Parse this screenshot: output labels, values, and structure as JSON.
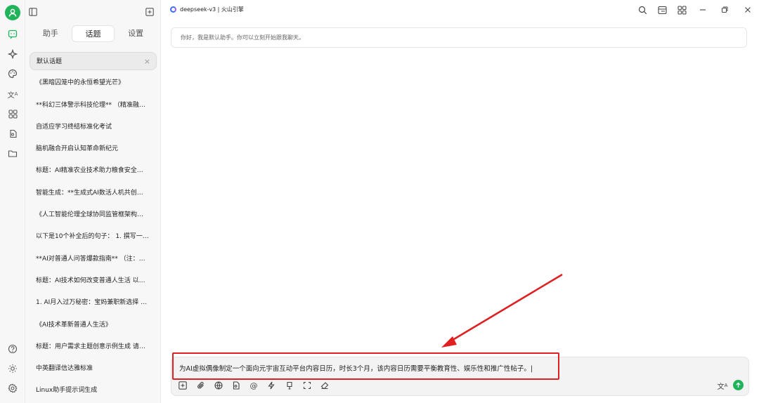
{
  "window": {
    "model_label": "deepseek-v3 | 火山引擎"
  },
  "sidebar": {
    "tabs": [
      "助手",
      "话题",
      "设置"
    ],
    "active_tab": "话题",
    "topics": [
      "默认话题",
      "《黑暗囚笼中的永恒希望光芒》",
      "**科幻三体警示科技伦理** （精准融…",
      "自适应学习终结标准化考试",
      "脑机融合开启认知革命新纪元",
      "标题：AI精准农业技术助力粮食安全…",
      "智能生成：**生成式AI数活人机共创…",
      "《人工智能伦理全球协同监管框架构…",
      "以下是10个补全后的句子：  1. 撰写一…",
      "**AI对普通人问答爆款指南** （注：…",
      "标题：AI技术如何改变普通人生活 以…",
      "1. AI月入过万秘密：宝妈兼职新选择 …",
      "《AI技术革新普通人生活》",
      "标题：用户需求主题创意示例生成 请…",
      "中英翻译信达雅标准",
      "Linux助手提示词生成"
    ]
  },
  "chat": {
    "greeting": "你好，我是默认助手。你可以立刻开始跟我聊天。"
  },
  "input": {
    "value": "为AI虚拟偶像制定一个面向元宇宙互动平台内容日历，时长3个月，该内容日历需要平衡教育性、娱乐性和推广性帖子。|"
  },
  "colors": {
    "accent": "#1fb35a",
    "highlight": "#e02020",
    "brand_blue": "#3b6ef6"
  }
}
